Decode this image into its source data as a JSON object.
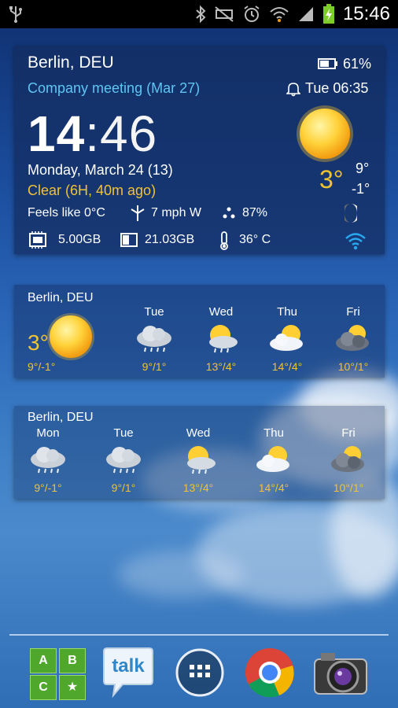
{
  "status_bar": {
    "time": "15:46",
    "icons": [
      "usb-icon",
      "bluetooth-icon",
      "mute-icon",
      "alarm-icon",
      "wifi-icon",
      "signal-icon",
      "battery-charging-icon"
    ]
  },
  "main_widget": {
    "city": "Berlin, DEU",
    "battery": "61%",
    "event": "Company meeting (Mar 27)",
    "alarm": "Tue 06:35",
    "time_hours": "14",
    "time_sep": ":",
    "time_minutes": "46",
    "date": "Monday, March 24  (13)",
    "condition": "Clear  (6H, 40m ago)",
    "current_temp": "3°",
    "high": "9°",
    "low": "-1°",
    "feels_like": "Feels like 0°C",
    "wind": "7 mph W",
    "humidity": "87%",
    "memory": "5.00GB",
    "storage": "21.03GB",
    "battery_temp": "36° C"
  },
  "forecast_widget_1": {
    "city": "Berlin, DEU",
    "current_temp": "3°",
    "current_range": "9°/-1°",
    "days": [
      {
        "day": "Tue",
        "range": "9°/1°",
        "icon": "rain-cloud-icon"
      },
      {
        "day": "Wed",
        "range": "13°/4°",
        "icon": "sun-rain-icon"
      },
      {
        "day": "Thu",
        "range": "14°/4°",
        "icon": "partly-cloudy-icon"
      },
      {
        "day": "Fri",
        "range": "10°/1°",
        "icon": "dark-cloud-sun-icon"
      }
    ]
  },
  "forecast_widget_2": {
    "city": "Berlin, DEU",
    "days": [
      {
        "day": "Mon",
        "range": "9°/-1°",
        "icon": "rain-cloud-icon"
      },
      {
        "day": "Tue",
        "range": "9°/1°",
        "icon": "rain-cloud-icon"
      },
      {
        "day": "Wed",
        "range": "13°/4°",
        "icon": "sun-rain-icon"
      },
      {
        "day": "Thu",
        "range": "14°/4°",
        "icon": "partly-cloudy-icon"
      },
      {
        "day": "Fri",
        "range": "10°/1°",
        "icon": "dark-cloud-sun-icon"
      }
    ]
  },
  "dock": {
    "abc_tiles": [
      "A",
      "B",
      "C",
      "★"
    ],
    "talk_label": "talk",
    "apps": [
      "abc-app-icon",
      "talk-app-icon",
      "app-drawer-icon",
      "chrome-icon",
      "camera-icon"
    ]
  },
  "colors": {
    "accent_cyan": "#5fc6f2",
    "accent_yellow": "#f1c232",
    "panel": "#142d5f"
  }
}
